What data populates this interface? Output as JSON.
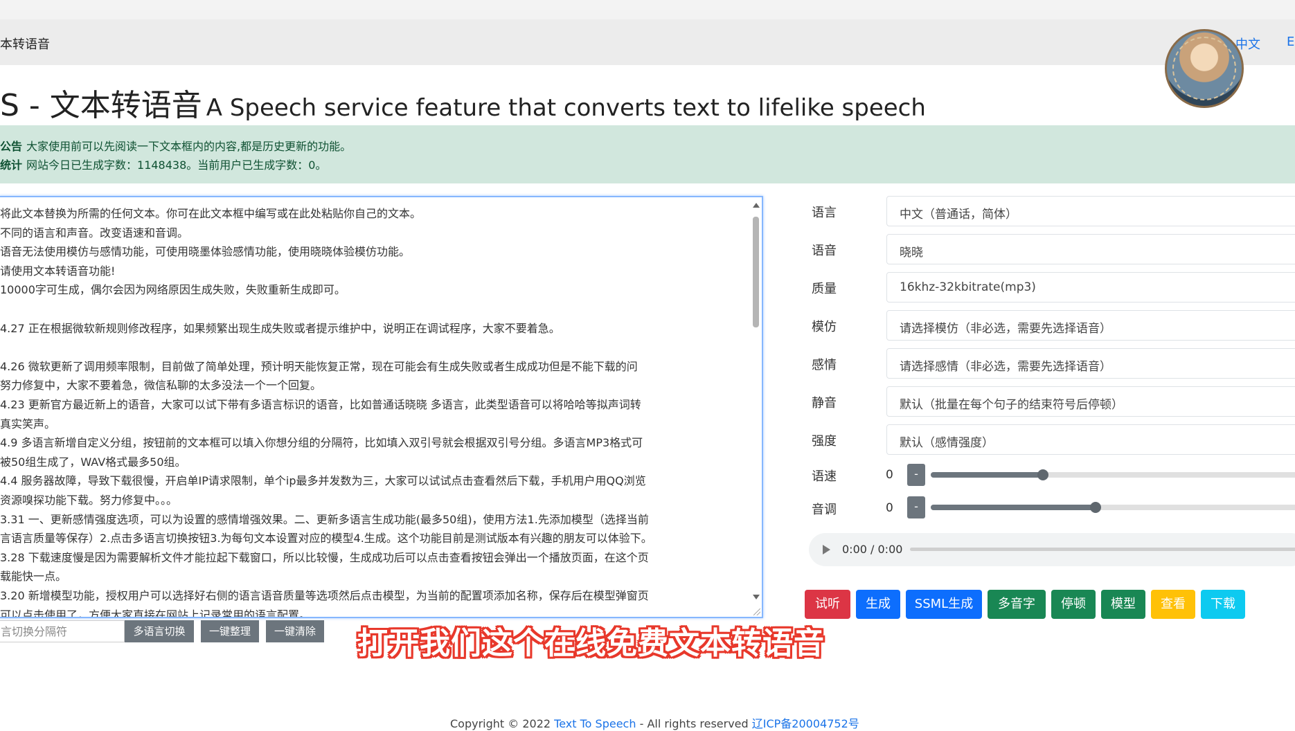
{
  "nav": {
    "brand": "本转语音",
    "lang_zh": "中文",
    "lang_en": "En"
  },
  "header": {
    "title_zh": "S - 文本转语音",
    "title_en": "A Speech service feature that converts text to lifelike speech"
  },
  "alert": {
    "notice_label": "公告",
    "notice_text": "大家使用前可以先阅读一下文本框内的内容,都是历史更新的功能。",
    "stats_label": "统计",
    "stats_text": "网站今日已生成字数：1148438。当前用户已生成字数：0。"
  },
  "editor": {
    "lines": [
      "将此文本替换为所需的任何文本。你可在此文本框中编写或在此处粘贴你自己的文本。",
      "不同的语言和声音。改变语速和音调。",
      "语音无法使用模仿与感情功能，可使用晓墨体验感情功能，使用晓晓体验模仿功能。",
      "请使用文本转语音功能!",
      "10000字可生成，偶尔会因为网络原因生成失败，失败重新生成即可。",
      "",
      "4.27 正在根据微软新规则修改程序，如果频繁出现生成失败或者提示维护中，说明正在调试程序，大家不要着急。",
      "",
      "4.26 微软更新了调用频率限制，目前做了简单处理，预计明天能恢复正常，现在可能会有生成失败或者生成成功但是不能下载的问",
      "努力修复中，大家不要着急，微信私聊的太多没法一个一个回复。",
      "4.23 更新官方最近新上的语音，大家可以试下带有多语言标识的语音，比如普通话晓晓 多语言，此类型语音可以将哈哈等拟声词转",
      "真实笑声。",
      "4.9 多语言新增自定义分组，按钮前的文本框可以填入你想分组的分隔符，比如填入双引号就会根据双引号分组。多语言MP3格式可",
      "被50组生成了，WAV格式最多50组。",
      "4.4 服务器故障，导致下载很慢，开启单IP请求限制，单个ip最多并发数为三，大家可以试试点击查看然后下载，手机用户用QQ浏览",
      "资源嗅探功能下载。努力修复中。。。",
      "3.31 一、更新感情强度选项，可以为设置的感情增强效果。二、更新多语言生成功能(最多50组)，使用方法1.先添加模型（选择当前",
      "言语言质量等保存）2.点击多语言切换按钮3.为每句文本设置对应的模型4.生成。这个功能目前是测试版本有兴趣的朋友可以体验下。",
      "3.28 下载速度慢是因为需要解析文件才能拉起下载窗口，所以比较慢，生成成功后可以点击查看按钮会弹出一个播放页面，在这个页",
      "载能快一点。",
      "3.20 新增模型功能，授权用户可以选择好右侧的语言语音质量等选项然后点击模型，为当前的配置项添加名称，保存后在模型弹窗页",
      "可以点击使用了，方便大家直接在网站上记录常用的语言配置。"
    ],
    "separator_placeholder": "言切换分隔符",
    "btn_multilang": "多语言切换",
    "btn_tidy": "一键整理",
    "btn_clear": "一键清除"
  },
  "settings": {
    "fields": [
      {
        "label": "语言",
        "value": "中文（普通话，简体）"
      },
      {
        "label": "语音",
        "value": "晓晓"
      },
      {
        "label": "质量",
        "value": "16khz-32kbitrate(mp3)"
      },
      {
        "label": "模仿",
        "value": "请选择模仿（非必选，需要先选择语音）"
      },
      {
        "label": "感情",
        "value": "请选择感情（非必选，需要先选择语音）"
      },
      {
        "label": "静音",
        "value": "默认（批量在每个句子的结束符号后停顿）"
      },
      {
        "label": "强度",
        "value": "默认（感情强度）"
      }
    ],
    "speed": {
      "label": "语速",
      "value": "0",
      "minus": "-",
      "level": 0.3
    },
    "pitch": {
      "label": "音调",
      "value": "0",
      "minus": "-",
      "level": 0.44
    }
  },
  "player": {
    "time": "0:00 / 0:00"
  },
  "actions": [
    {
      "label": "试听",
      "color": "#dc3545"
    },
    {
      "label": "生成",
      "color": "#0d6efd"
    },
    {
      "label": "SSML生成",
      "color": "#0d6efd"
    },
    {
      "label": "多音字",
      "color": "#198754"
    },
    {
      "label": "停顿",
      "color": "#198754"
    },
    {
      "label": "模型",
      "color": "#198754"
    },
    {
      "label": "查看",
      "color": "#ffc107"
    },
    {
      "label": "下载",
      "color": "#0dcaf0"
    }
  ],
  "overlay": {
    "subtitle": "打开我们这个在线免费文本转语音"
  },
  "footer": {
    "copyright": "Copyright © 2022",
    "site_link": "Text To Speech",
    "rights": "- All rights reserved",
    "icp_link": "辽ICP备20004752号"
  }
}
